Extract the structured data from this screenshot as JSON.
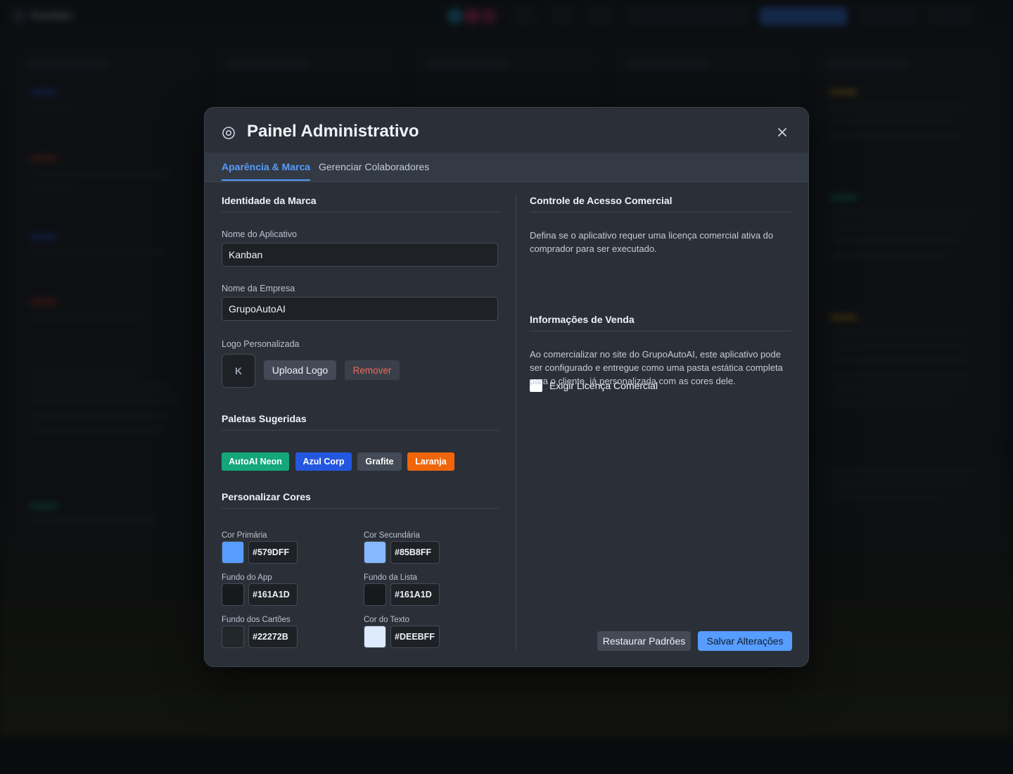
{
  "modal": {
    "title": "Painel Administrativo",
    "tabs": [
      {
        "label": "Aparência & Marca"
      },
      {
        "label": "Gerenciar Colaboradores"
      }
    ]
  },
  "brand": {
    "section_title": "Identidade da Marca",
    "app_name_label": "Nome do Aplicativo",
    "app_name_value": "Kanban",
    "company_label": "Nome da Empresa",
    "company_value": "GrupoAutoAI",
    "logo_label": "Logo Personalizada",
    "logo_placeholder": "K",
    "upload_label": "Upload Logo",
    "remove_label": "Remover"
  },
  "palettes": {
    "section_title": "Paletas Sugeridas",
    "items": [
      {
        "label": "AutoAI Neon",
        "color": "#13A77A"
      },
      {
        "label": "Azul Corp",
        "color": "#2357E0"
      },
      {
        "label": "Grafite",
        "color": "#434B57"
      },
      {
        "label": "Laranja",
        "color": "#F0650A"
      }
    ]
  },
  "colors": {
    "section_title": "Personalizar Cores",
    "items": [
      {
        "label": "Cor Primária",
        "value": "#579DFF"
      },
      {
        "label": "Cor Secundária",
        "value": "#85B8FF"
      },
      {
        "label": "Fundo do App",
        "value": "#161A1D"
      },
      {
        "label": "Fundo da Lista",
        "value": "#161A1D"
      },
      {
        "label": "Fundo dos Cartões",
        "value": "#22272B"
      },
      {
        "label": "Cor do Texto",
        "value": "#DEEBFF"
      }
    ]
  },
  "access": {
    "section_title": "Controle de Acesso Comercial",
    "description": "Defina se o aplicativo requer uma licença comercial ativa do comprador para ser executado.",
    "checkbox_label": "Exigir Licença Comercial",
    "checked": false
  },
  "sales": {
    "section_title": "Informações de Venda",
    "description": "Ao comercializar no site do GrupoAutoAI, este aplicativo pode ser configurado e entregue como uma pasta estática completa para o cliente, já personalizada com as cores dele."
  },
  "footer": {
    "reset_label": "Restaurar Padrões",
    "save_label": "Salvar Alterações"
  },
  "background": {
    "app_title": "Kanban"
  },
  "accent_color": "#579DFF"
}
